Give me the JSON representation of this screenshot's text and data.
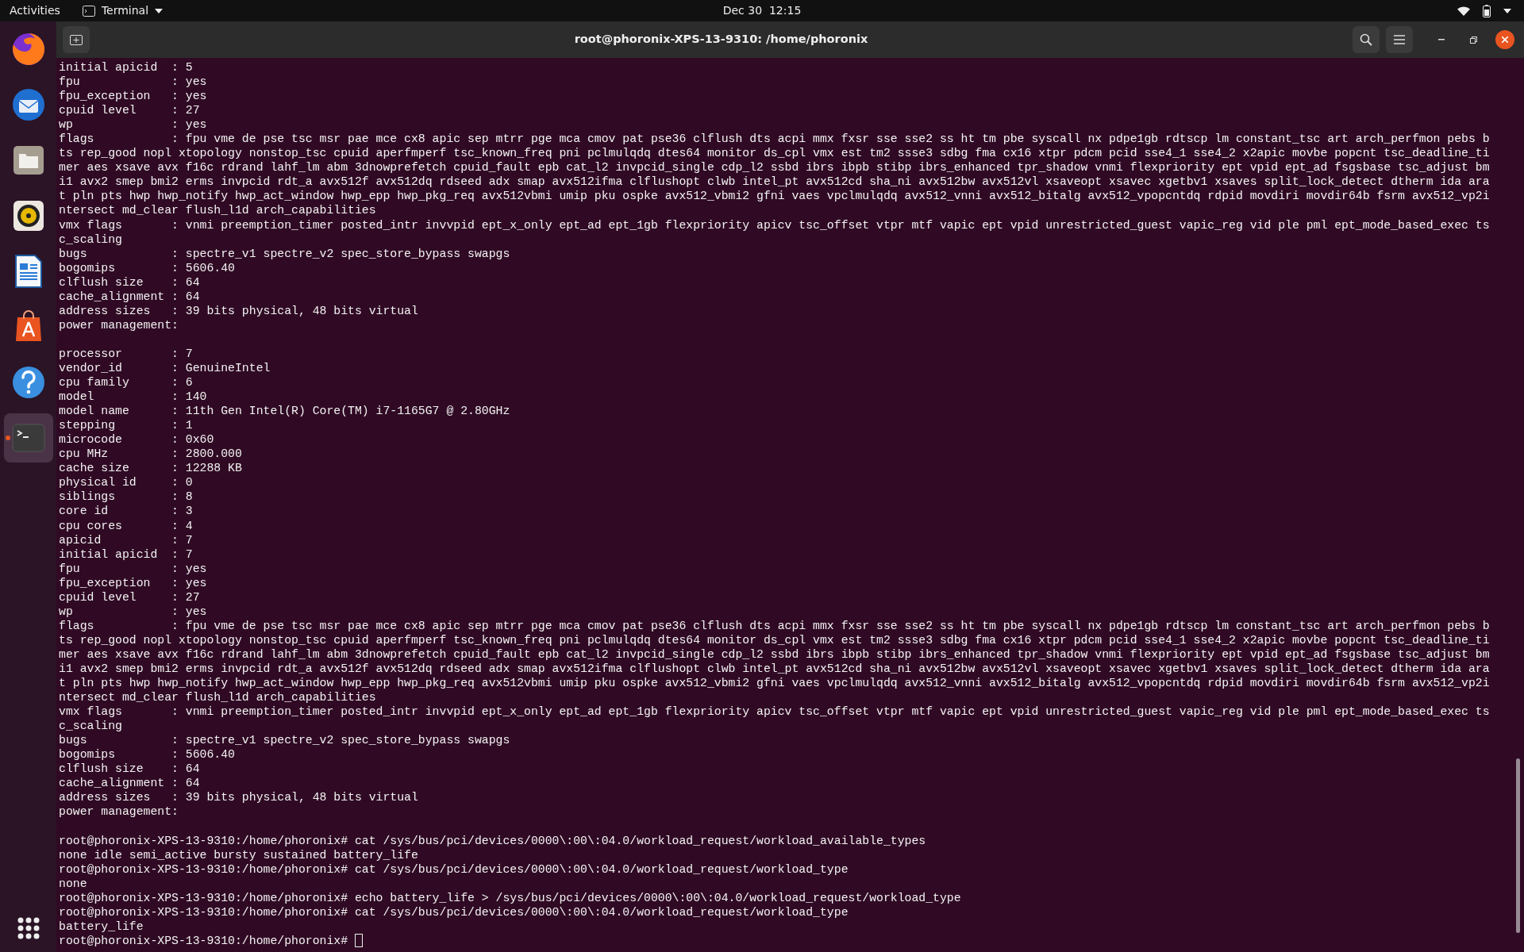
{
  "top_bar": {
    "activities": "Activities",
    "app_menu": "Terminal",
    "clock": "Dec 30  12:15"
  },
  "dock": [
    {
      "kind": "browser",
      "selected": false,
      "running": false
    },
    {
      "kind": "mail",
      "selected": false,
      "running": false
    },
    {
      "kind": "folder",
      "selected": false,
      "running": false
    },
    {
      "kind": "speaker",
      "selected": false,
      "running": false
    },
    {
      "kind": "document",
      "selected": false,
      "running": false
    },
    {
      "kind": "store",
      "selected": false,
      "running": false
    },
    {
      "kind": "help",
      "selected": false,
      "running": false
    },
    {
      "kind": "terminal",
      "selected": true,
      "running": true
    }
  ],
  "window": {
    "title": "root@phoronix-XPS-13-9310: /home/phoronix"
  },
  "terminal": {
    "cursor_visible": true,
    "blocks": [
      [
        "initial apicid  : 5",
        "fpu             : yes",
        "fpu_exception   : yes",
        "cpuid level     : 27",
        "wp              : yes",
        "flags           : fpu vme de pse tsc msr pae mce cx8 apic sep mtrr pge mca cmov pat pse36 clflush dts acpi mmx fxsr sse sse2 ss ht tm pbe syscall nx pdpe1gb rdtscp lm constant_tsc art arch_perfmon pebs b",
        "ts rep_good nopl xtopology nonstop_tsc cpuid aperfmperf tsc_known_freq pni pclmulqdq dtes64 monitor ds_cpl vmx est tm2 ssse3 sdbg fma cx16 xtpr pdcm pcid sse4_1 sse4_2 x2apic movbe popcnt tsc_deadline_ti",
        "mer aes xsave avx f16c rdrand lahf_lm abm 3dnowprefetch cpuid_fault epb cat_l2 invpcid_single cdp_l2 ssbd ibrs ibpb stibp ibrs_enhanced tpr_shadow vnmi flexpriority ept vpid ept_ad fsgsbase tsc_adjust bm",
        "i1 avx2 smep bmi2 erms invpcid rdt_a avx512f avx512dq rdseed adx smap avx512ifma clflushopt clwb intel_pt avx512cd sha_ni avx512bw avx512vl xsaveopt xsavec xgetbv1 xsaves split_lock_detect dtherm ida ara",
        "t pln pts hwp hwp_notify hwp_act_window hwp_epp hwp_pkg_req avx512vbmi umip pku ospke avx512_vbmi2 gfni vaes vpclmulqdq avx512_vnni avx512_bitalg avx512_vpopcntdq rdpid movdiri movdir64b fsrm avx512_vp2i",
        "ntersect md_clear flush_l1d arch_capabilities",
        "vmx flags       : vnmi preemption_timer posted_intr invvpid ept_x_only ept_ad ept_1gb flexpriority apicv tsc_offset vtpr mtf vapic ept vpid unrestricted_guest vapic_reg vid ple pml ept_mode_based_exec ts",
        "c_scaling",
        "bugs            : spectre_v1 spectre_v2 spec_store_bypass swapgs",
        "bogomips        : 5606.40",
        "clflush size    : 64",
        "cache_alignment : 64",
        "address sizes   : 39 bits physical, 48 bits virtual",
        "power management:"
      ],
      [
        "processor       : 7",
        "vendor_id       : GenuineIntel",
        "cpu family      : 6",
        "model           : 140",
        "model name      : 11th Gen Intel(R) Core(TM) i7-1165G7 @ 2.80GHz",
        "stepping        : 1",
        "microcode       : 0x60",
        "cpu MHz         : 2800.000",
        "cache size      : 12288 KB",
        "physical id     : 0",
        "siblings        : 8",
        "core id         : 3",
        "cpu cores       : 4",
        "apicid          : 7",
        "initial apicid  : 7",
        "fpu             : yes",
        "fpu_exception   : yes",
        "cpuid level     : 27",
        "wp              : yes",
        "flags           : fpu vme de pse tsc msr pae mce cx8 apic sep mtrr pge mca cmov pat pse36 clflush dts acpi mmx fxsr sse sse2 ss ht tm pbe syscall nx pdpe1gb rdtscp lm constant_tsc art arch_perfmon pebs b",
        "ts rep_good nopl xtopology nonstop_tsc cpuid aperfmperf tsc_known_freq pni pclmulqdq dtes64 monitor ds_cpl vmx est tm2 ssse3 sdbg fma cx16 xtpr pdcm pcid sse4_1 sse4_2 x2apic movbe popcnt tsc_deadline_ti",
        "mer aes xsave avx f16c rdrand lahf_lm abm 3dnowprefetch cpuid_fault epb cat_l2 invpcid_single cdp_l2 ssbd ibrs ibpb stibp ibrs_enhanced tpr_shadow vnmi flexpriority ept vpid ept_ad fsgsbase tsc_adjust bm",
        "i1 avx2 smep bmi2 erms invpcid rdt_a avx512f avx512dq rdseed adx smap avx512ifma clflushopt clwb intel_pt avx512cd sha_ni avx512bw avx512vl xsaveopt xsavec xgetbv1 xsaves split_lock_detect dtherm ida ara",
        "t pln pts hwp hwp_notify hwp_act_window hwp_epp hwp_pkg_req avx512vbmi umip pku ospke avx512_vbmi2 gfni vaes vpclmulqdq avx512_vnni avx512_bitalg avx512_vpopcntdq rdpid movdiri movdir64b fsrm avx512_vp2i",
        "ntersect md_clear flush_l1d arch_capabilities",
        "vmx flags       : vnmi preemption_timer posted_intr invvpid ept_x_only ept_ad ept_1gb flexpriority apicv tsc_offset vtpr mtf vapic ept vpid unrestricted_guest vapic_reg vid ple pml ept_mode_based_exec ts",
        "c_scaling",
        "bugs            : spectre_v1 spectre_v2 spec_store_bypass swapgs",
        "bogomips        : 5606.40",
        "clflush size    : 64",
        "cache_alignment : 64",
        "address sizes   : 39 bits physical, 48 bits virtual",
        "power management:"
      ],
      [
        "root@phoronix-XPS-13-9310:/home/phoronix# cat /sys/bus/pci/devices/0000\\:00\\:04.0/workload_request/workload_available_types",
        "none idle semi_active bursty sustained battery_life",
        "root@phoronix-XPS-13-9310:/home/phoronix# cat /sys/bus/pci/devices/0000\\:00\\:04.0/workload_request/workload_type",
        "none",
        "root@phoronix-XPS-13-9310:/home/phoronix# echo battery_life > /sys/bus/pci/devices/0000\\:00\\:04.0/workload_request/workload_type",
        "root@phoronix-XPS-13-9310:/home/phoronix# cat /sys/bus/pci/devices/0000\\:00\\:04.0/workload_request/workload_type",
        "battery_life",
        "root@phoronix-XPS-13-9310:/home/phoronix#"
      ]
    ]
  }
}
